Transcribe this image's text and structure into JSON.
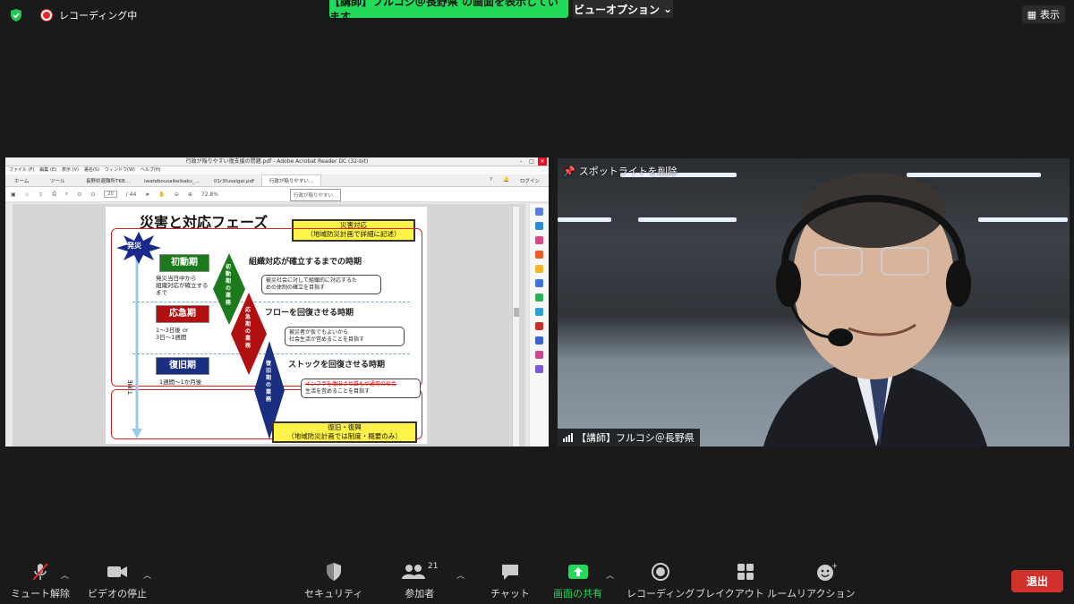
{
  "top": {
    "recording": "レコーディング中",
    "share_banner": "【講師】フルコシ＠長野県 の画面を表示しています",
    "view_options": "ビューオプション",
    "display": "表示"
  },
  "acrobat": {
    "window_title": "行政が陥りやすい復支援の問題.pdf - Adobe Acrobat Reader DC (32-bit)",
    "menu": [
      "ファイル (F)",
      "編集 (E)",
      "表示 (V)",
      "署名(S)",
      "ウィンドウ(W)",
      "ヘルプ(H)"
    ],
    "tabs": [
      "ホーム",
      "ツール",
      "長野県避難所TKB...",
      "iwatebousaikeikaku_...",
      "01r3fusaigai.pdf",
      "行政が陥りやすい..."
    ],
    "login": "ログイン",
    "page_current": "20",
    "page_total": "/ 44",
    "zoom": "72.8%",
    "tooltip": "行政が陥りやすい..."
  },
  "slide": {
    "title": "災害と対応フェーズ",
    "yellow_top": [
      "災害対応",
      "（地域防災計画で詳細に記述）"
    ],
    "yellow_bottom": [
      "復旧・復興",
      "（地域防災計画では制度・概要のみ）"
    ],
    "hassai": "発災",
    "time": "TIME",
    "phase1": {
      "label": "初動期",
      "desc": [
        "発災当日中から",
        "組織対応が確立する",
        "まで"
      ],
      "heading": "組織対応が確立するまでの時期",
      "note": [
        "被災社会に対して組織的に対応するた",
        "めの体制の確立を目指す"
      ],
      "diamond": "初動期の業務"
    },
    "phase2": {
      "label": "応急期",
      "desc": [
        "1～3日後 or",
        "3日～1週間"
      ],
      "heading": "フローを回復させる時期",
      "note": [
        "被災者が仮でもよいから",
        "社会生活が営めることを目指す"
      ],
      "diamond": "応急期の業務"
    },
    "phase3": {
      "label": "復旧期",
      "desc": [
        "1週間～1か月後"
      ],
      "heading": "ストックを回復させる時期",
      "note": [
        "インフラを復旧させ誰もが通常の社会",
        "生活を営めることを目指す"
      ],
      "diamond": "復旧期の業務"
    }
  },
  "camera": {
    "spotlight": "スポットライトを削除",
    "name": "【講師】フルコシ＠長野県"
  },
  "toolbar": {
    "unmute": "ミュート解除",
    "stop_video": "ビデオの停止",
    "security": "セキュリティ",
    "participants": "参加者",
    "participants_count": "21",
    "chat": "チャット",
    "share": "画面の共有",
    "record": "レコーディング",
    "breakout": "ブレイクアウト ルーム",
    "reactions": "リアクション",
    "leave": "退出"
  },
  "colors": {
    "share_green": "#23d959",
    "leave_red": "#d0312d",
    "phase_green": "#1b7a1b",
    "phase_red": "#b01010",
    "phase_blue": "#1a2f80"
  }
}
